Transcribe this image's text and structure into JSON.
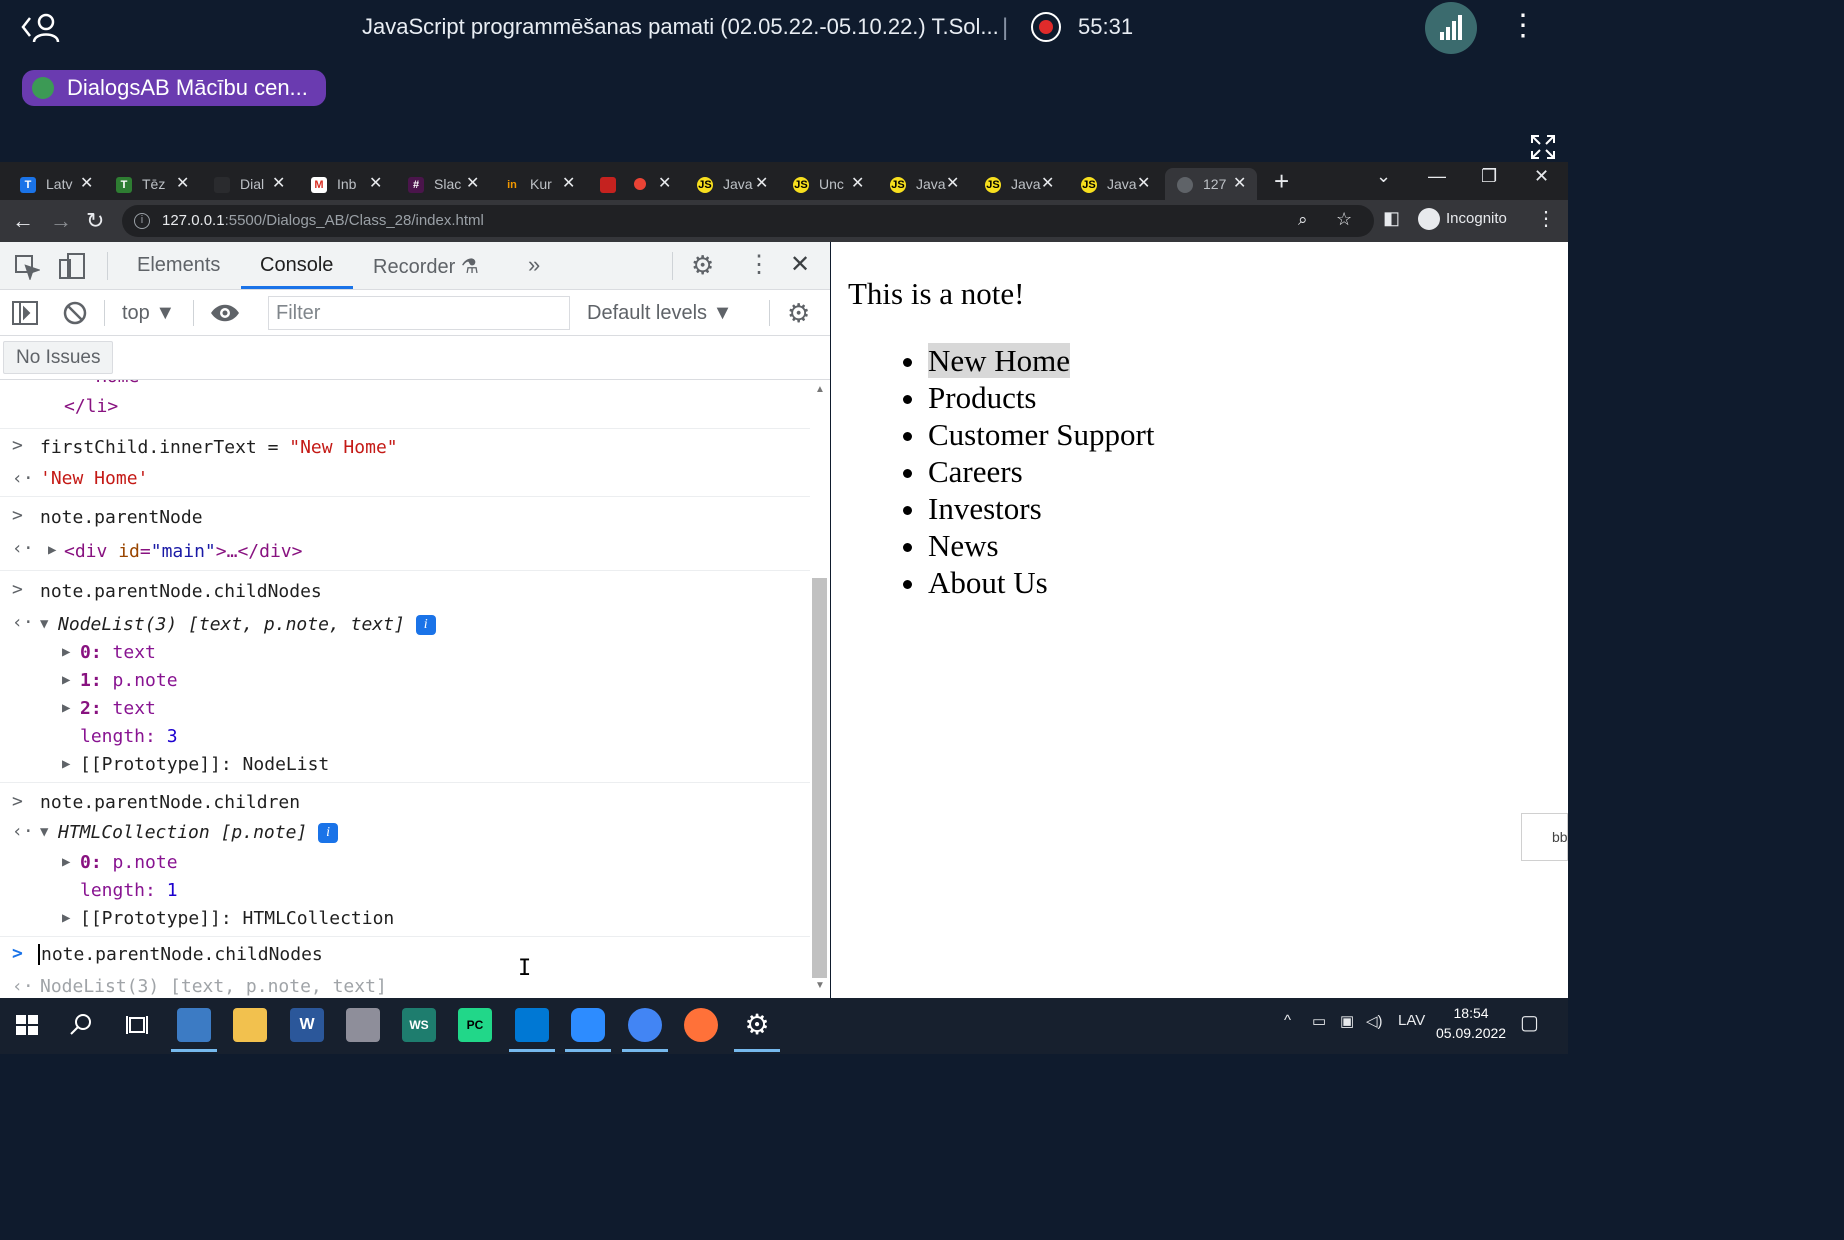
{
  "meeting": {
    "title": "JavaScript programmēšanas pamati (02.05.22.-05.10.22.) T.Sol...",
    "timer": "55:31",
    "speaker": "DialogsAB Mācību cen...",
    "colors": {
      "record": "#e02b2b",
      "speaker_pill": "#6a3bb0",
      "signal": "#3b6b6e"
    }
  },
  "browser": {
    "tabs": [
      {
        "label": "Latv",
        "icon": "T"
      },
      {
        "label": "Tēz",
        "icon": "T"
      },
      {
        "label": "Dial",
        "icon": ""
      },
      {
        "label": "Inb",
        "icon": "M"
      },
      {
        "label": "Slac",
        "icon": "#"
      },
      {
        "label": "Kur",
        "icon": "in"
      },
      {
        "label": "",
        "icon": ""
      },
      {
        "label": "Java",
        "icon": "JS"
      },
      {
        "label": "Unc",
        "icon": "JS"
      },
      {
        "label": "Java",
        "icon": "JS"
      },
      {
        "label": "Java",
        "icon": "JS"
      },
      {
        "label": "Java",
        "icon": "JS"
      },
      {
        "label": "127",
        "icon": ""
      }
    ],
    "url_host": "127.0.0.1",
    "url_path": ":5500/Dialogs_AB/Class_28/index.html",
    "incognito_label": "Incognito"
  },
  "devtools": {
    "tabs": [
      "Elements",
      "Console",
      "Recorder"
    ],
    "context": "top",
    "filter_placeholder": "Filter",
    "levels": "Default levels",
    "issues": "No Issues",
    "console": {
      "frag_close_li": "</li>",
      "cmd1": "firstChild.innerText = ",
      "cmd1_str": "\"New Home\"",
      "res1": "'New Home'",
      "cmd2": "note.parentNode",
      "res2_tag_open": "<div",
      "res2_attr": "id",
      "res2_val": "\"main\"",
      "res2_rest": ">…</div>",
      "cmd3": "note.parentNode.childNodes",
      "res3_head": "NodeList(3) ",
      "res3_items": "[text, p.note, text]",
      "res3_entries": [
        {
          "key": "0:",
          "val": "text"
        },
        {
          "key": "1:",
          "val": "p.note"
        },
        {
          "key": "2:",
          "val": "text"
        }
      ],
      "res3_length_key": "length:",
      "res3_length": "3",
      "res3_proto": "[[Prototype]]: NodeList",
      "cmd4": "note.parentNode.children",
      "res4_head": "HTMLCollection ",
      "res4_items": "[p.note]",
      "res4_entry_key": "0:",
      "res4_entry_val": "p.note",
      "res4_length_key": "length:",
      "res4_length": "1",
      "res4_proto": "[[Prototype]]: HTMLCollection",
      "input_text": "note.parentNode.childNodes",
      "preview": "NodeList(3) [text, p.note, text]"
    }
  },
  "page": {
    "note": "This is a note!",
    "menu": [
      "New Home",
      "Products",
      "Customer Support",
      "Careers",
      "Investors",
      "News",
      "About Us"
    ],
    "side_tab": "bb"
  },
  "taskbar": {
    "lang": "LAV",
    "time": "18:54",
    "date": "05.09.2022"
  }
}
